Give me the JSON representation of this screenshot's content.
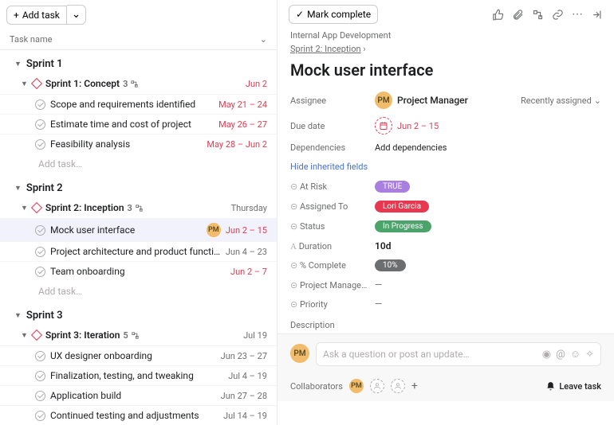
{
  "toolbar": {
    "add_task": "Add task"
  },
  "columns": {
    "task_name": "Task name"
  },
  "sections": [
    {
      "name": "Sprint 1",
      "subsection": {
        "name": "Sprint 1: Concept",
        "meta_count": "3",
        "date": "Jun 2",
        "date_class": "red"
      },
      "tasks": [
        {
          "title": "Scope and requirements identified",
          "date": "May 21 – 24",
          "date_class": "red"
        },
        {
          "title": "Estimate time and cost of project",
          "date": "May 26 – 27",
          "date_class": "red"
        },
        {
          "title": "Feasibility analysis",
          "date": "May 28 – Jun 2",
          "date_class": "red"
        }
      ],
      "add_task": "Add task…"
    },
    {
      "name": "Sprint 2",
      "subsection": {
        "name": "Sprint 2: Inception",
        "meta_count": "3",
        "date": "Thursday",
        "date_class": "gray"
      },
      "tasks": [
        {
          "title": "Mock user interface",
          "date": "Jun 2 – 15",
          "date_class": "red",
          "selected": true,
          "assignee": "PM"
        },
        {
          "title": "Project architecture and product functionality",
          "date": "Jun 4 – 23",
          "date_class": "gray"
        },
        {
          "title": "Team onboarding",
          "date": "Jun 2 – 7",
          "date_class": "red"
        }
      ],
      "add_task": "Add task…"
    },
    {
      "name": "Sprint 3",
      "subsection": {
        "name": "Sprint 3: Iteration",
        "meta_count": "5",
        "date": "Jul 19",
        "date_class": "gray"
      },
      "tasks": [
        {
          "title": "UX designer onboarding",
          "date": "Jun 23 – 27",
          "date_class": "gray"
        },
        {
          "title": "Finalization, testing, and tweaking",
          "date": "Jul 4 – 19",
          "date_class": "gray"
        },
        {
          "title": "Application build",
          "date": "Jun 27 – 28",
          "date_class": "gray"
        },
        {
          "title": "Continued testing and adjustments",
          "date": "Jul 14 – 19",
          "date_class": "gray"
        }
      ]
    }
  ],
  "detail": {
    "mark_complete": "Mark complete",
    "breadcrumb_project": "Internal App Development",
    "breadcrumb_section": "Sprint 2: Inception",
    "title": "Mock user interface",
    "labels": {
      "assignee": "Assignee",
      "due_date": "Due date",
      "dependencies": "Dependencies",
      "at_risk": "At Risk",
      "assigned_to": "Assigned To",
      "status": "Status",
      "duration": "Duration",
      "pct_complete": "% Complete",
      "project_manage": "Project Manage…",
      "priority": "Priority",
      "description": "Description"
    },
    "assignee_initials": "PM",
    "assignee_name": "Project Manager",
    "recently_assigned": "Recently assigned",
    "due_date_value": "Jun 2 – 15",
    "add_dependencies": "Add dependencies",
    "hide_inherited": "Hide inherited fields",
    "at_risk_value": "TRUE",
    "assigned_to_value": "Lori Garcia",
    "status_value": "In Progress",
    "duration_value": "10d",
    "pct_complete_value": "10%",
    "empty": "—",
    "comment_placeholder": "Ask a question or post an update…",
    "collaborators_label": "Collaborators",
    "leave_task": "Leave task",
    "plus": "+"
  }
}
